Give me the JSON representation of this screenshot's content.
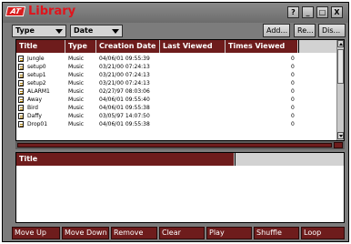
{
  "window": {
    "logo_text": "AT",
    "title": "Library",
    "controls": [
      "?",
      "_",
      "□",
      "X"
    ]
  },
  "toolbar": {
    "type_dropdown": "Type",
    "date_dropdown": "Date",
    "add_button": "Add...",
    "rename_button": "Re...",
    "display_button": "Dis..."
  },
  "library_table": {
    "columns": [
      "Title",
      "Type",
      "Creation Date",
      "Last Viewed",
      "Times Viewed"
    ],
    "rows": [
      {
        "title": "Jungle",
        "type": "Music",
        "created": "04/06/01 09:55:39",
        "viewed": "",
        "times": "0"
      },
      {
        "title": "setup0",
        "type": "Music",
        "created": "03/21/00 07:24:13",
        "viewed": "",
        "times": "0"
      },
      {
        "title": "setup1",
        "type": "Music",
        "created": "03/21/00 07:24:13",
        "viewed": "",
        "times": "0"
      },
      {
        "title": "setup2",
        "type": "Music",
        "created": "03/21/00 07:24:13",
        "viewed": "",
        "times": "0"
      },
      {
        "title": "ALARM1",
        "type": "Music",
        "created": "02/27/97 08:03:06",
        "viewed": "",
        "times": "0"
      },
      {
        "title": "Away",
        "type": "Music",
        "created": "04/06/01 09:55:40",
        "viewed": "",
        "times": "0"
      },
      {
        "title": "Bird",
        "type": "Music",
        "created": "04/06/01 09:55:38",
        "viewed": "",
        "times": "0"
      },
      {
        "title": "Daffy",
        "type": "Music",
        "created": "03/05/97 14:07:50",
        "viewed": "",
        "times": "0"
      },
      {
        "title": "Drop01",
        "type": "Music",
        "created": "04/06/01 09:55:38",
        "viewed": "",
        "times": "0"
      }
    ]
  },
  "playlist_table": {
    "columns": [
      "Title"
    ]
  },
  "bottom_buttons": [
    "Move Up",
    "Move Down",
    "Remove",
    "Clear",
    "Play",
    "Shuffle",
    "Loop"
  ]
}
